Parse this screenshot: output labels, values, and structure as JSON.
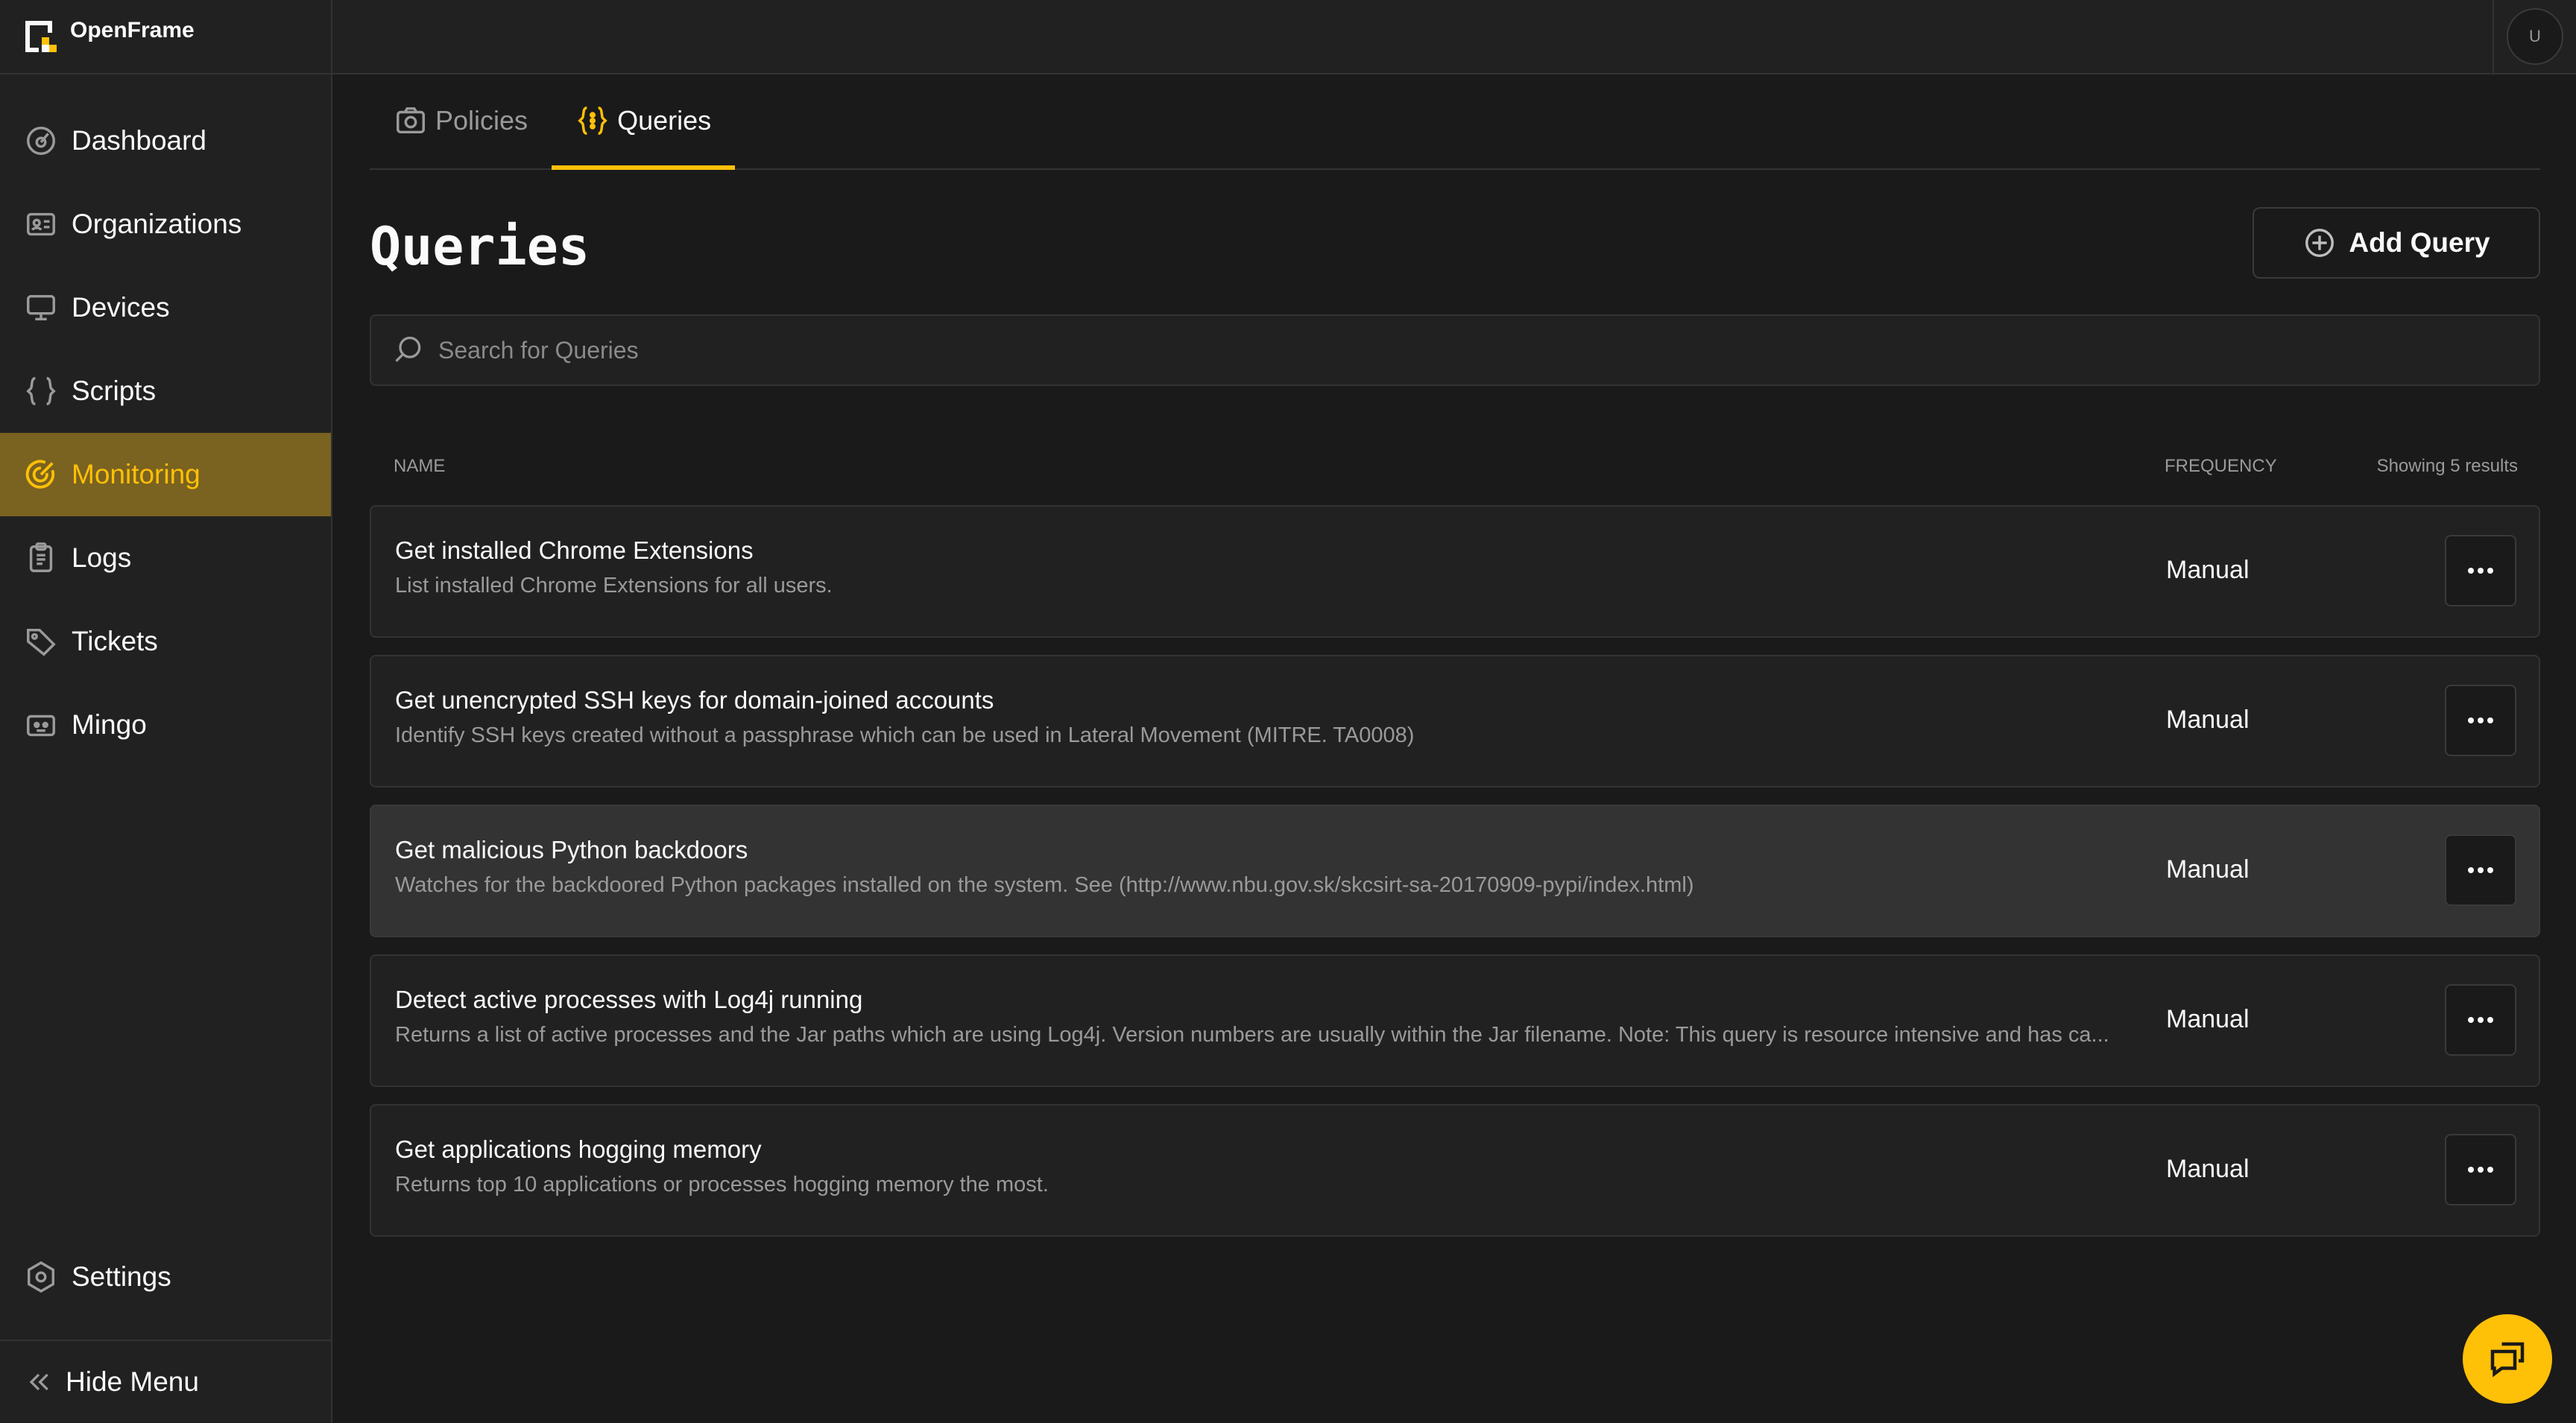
{
  "app": {
    "name": "OpenFrame"
  },
  "sidebar": {
    "items": [
      {
        "label": "Dashboard",
        "icon": "dashboard-icon"
      },
      {
        "label": "Organizations",
        "icon": "organizations-icon"
      },
      {
        "label": "Devices",
        "icon": "monitor-icon"
      },
      {
        "label": "Scripts",
        "icon": "braces-icon"
      },
      {
        "label": "Monitoring",
        "icon": "monitoring-icon",
        "active": true
      },
      {
        "label": "Logs",
        "icon": "clipboard-icon"
      },
      {
        "label": "Tickets",
        "icon": "tag-icon"
      },
      {
        "label": "Mingo",
        "icon": "bot-icon"
      }
    ],
    "settings_label": "Settings",
    "hide_menu_label": "Hide Menu"
  },
  "topbar": {
    "avatar_initial": "U"
  },
  "tabs": [
    {
      "label": "Policies",
      "icon": "camera-icon",
      "active": false
    },
    {
      "label": "Queries",
      "icon": "braces-dots-icon",
      "active": true
    }
  ],
  "page": {
    "title": "Queries",
    "add_button_label": "Add Query",
    "search_placeholder": "Search for Queries"
  },
  "table": {
    "col_name": "NAME",
    "col_frequency": "FREQUENCY",
    "results_text": "Showing 5 results",
    "rows": [
      {
        "title": "Get installed Chrome Extensions",
        "description": "List installed Chrome Extensions for all users.",
        "frequency": "Manual"
      },
      {
        "title": "Get unencrypted SSH keys for domain-joined accounts",
        "description": "Identify SSH keys created without a passphrase which can be used in Lateral Movement (MITRE. TA0008)",
        "frequency": "Manual"
      },
      {
        "title": "Get malicious Python backdoors",
        "description": "Watches for the backdoored Python packages installed on the system. See (http://www.nbu.gov.sk/skcsirt-sa-20170909-pypi/index.html)",
        "frequency": "Manual"
      },
      {
        "title": "Detect active processes with Log4j running",
        "description": "Returns a list of active processes and the Jar paths which are using Log4j. Version numbers are usually within the Jar filename. Note: This query is resource intensive and has ca...",
        "frequency": "Manual"
      },
      {
        "title": "Get applications hogging memory",
        "description": "Returns top 10 applications or processes hogging memory the most.",
        "frequency": "Manual"
      }
    ]
  },
  "colors": {
    "accent": "#ffc008",
    "active_nav_bg": "#7a6220",
    "background": "#1a1a1a",
    "panel": "#212121"
  }
}
